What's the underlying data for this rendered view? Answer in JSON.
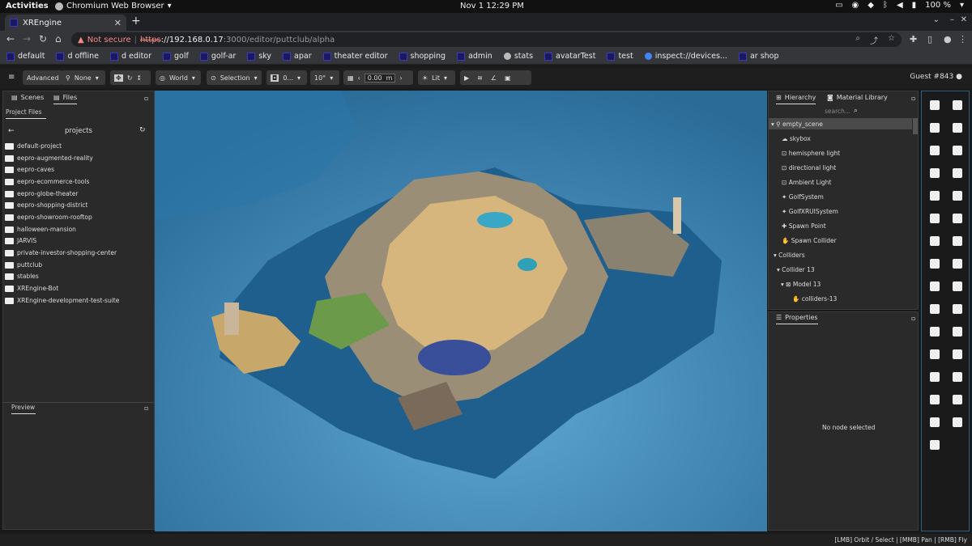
{
  "os_bar": {
    "activities": "Activities",
    "app_name": "Chromium Web Browser",
    "clock": "Nov 1  12:29 PM",
    "battery": "100 %"
  },
  "browser": {
    "tab_title": "XREngine",
    "security_label": "Not secure",
    "url_scheme": "https",
    "url_host": "://192.168.0.17",
    "url_path": ":3000/editor/puttclub/alpha",
    "bookmarks": [
      "default",
      "d offline",
      "d editor",
      "golf",
      "golf-ar",
      "sky",
      "apar",
      "theater editor",
      "shopping",
      "admin",
      "stats",
      "avatarTest",
      "test",
      "inspect://devices...",
      "ar shop"
    ]
  },
  "toolbar": {
    "mode_button": "Advanced",
    "transform_pivot": "None",
    "transform_space": "World",
    "snap_selection": "Selection",
    "grid_snap_value": "0...",
    "rotation_snap": "10°",
    "grid_height": "0.00",
    "grid_unit": "m",
    "render_mode": "Lit",
    "user": "Guest #843"
  },
  "left_panel": {
    "tabs": [
      "Scenes",
      "Files"
    ],
    "subtab": "Project Files",
    "folder_title": "projects",
    "projects": [
      "default-project",
      "eepro-augmented-reality",
      "eepro-caves",
      "eepro-ecommerce-tools",
      "eepro-globe-theater",
      "eepro-shopping-district",
      "eepro-showroom-rooftop",
      "halloween-mansion",
      "JARVIS",
      "private-investor-shopping-center",
      "puttclub",
      "stables",
      "XREngine-Bot",
      "XREngine-development-test-suite"
    ],
    "preview_label": "Preview"
  },
  "hierarchy": {
    "tabs": [
      "Hierarchy",
      "Material Library"
    ],
    "search_placeholder": "search...",
    "nodes": [
      {
        "label": "empty_scene",
        "depth": 0
      },
      {
        "label": "skybox",
        "depth": 1
      },
      {
        "label": "hemisphere light",
        "depth": 1
      },
      {
        "label": "directional light",
        "depth": 1
      },
      {
        "label": "Ambient Light",
        "depth": 1
      },
      {
        "label": "GolfSystem",
        "depth": 1
      },
      {
        "label": "GolfXRUISystem",
        "depth": 1
      },
      {
        "label": "Spawn Point",
        "depth": 1
      },
      {
        "label": "Spawn Collider",
        "depth": 1
      },
      {
        "label": "Colliders",
        "depth": 0
      },
      {
        "label": "Collider 13",
        "depth": 1
      },
      {
        "label": "Model 13",
        "depth": 2
      },
      {
        "label": "colliders-13",
        "depth": 3
      }
    ]
  },
  "properties": {
    "title": "Properties",
    "empty_message": "No node selected"
  },
  "status_bar": {
    "hint": "[LMB] Orbit / Select | [MMB] Pan | [RMB] Fly"
  },
  "colors": {
    "viewport_water": "#2e6fa0",
    "panel_bg": "#2a2a2a",
    "accent": "#2f5f80"
  }
}
